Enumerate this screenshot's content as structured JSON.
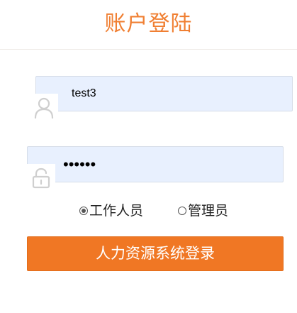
{
  "header": {
    "title": "账户登陆"
  },
  "form": {
    "username": {
      "value": "test3",
      "icon": "user-icon"
    },
    "password": {
      "value": "......",
      "icon": "unlock-icon"
    },
    "roles": [
      {
        "label": "工作人员",
        "checked": true
      },
      {
        "label": "管理员",
        "checked": false
      }
    ],
    "submit_label": "人力资源系统登录"
  },
  "colors": {
    "accent": "#f07f32",
    "button": "#f07724",
    "input_bg": "#e8f0fe",
    "icon": "#cfcfcf"
  }
}
